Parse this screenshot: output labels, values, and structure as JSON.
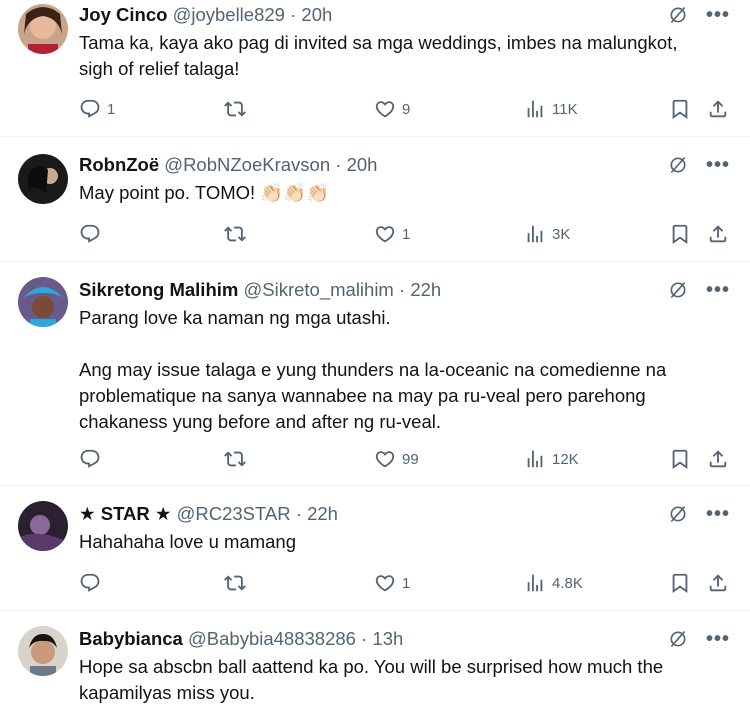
{
  "tweets": [
    {
      "name": "Joy Cinco",
      "handle": "@joybelle829",
      "time": "20h",
      "text": "Tama ka, kaya ako pag di invited sa mga weddings, imbes na malungkot,\nsigh of relief talaga!",
      "replies": "1",
      "retweets": "",
      "likes": "9",
      "views": "11K"
    },
    {
      "name": "RobnZoë",
      "handle": "@RobNZoeKravson",
      "time": "20h",
      "text": "May point po. TOMO! 👏🏻👏🏻👏🏻",
      "replies": "",
      "retweets": "",
      "likes": "1",
      "views": "3K"
    },
    {
      "name": "Sikretong Malihim",
      "handle": "@Sikreto_malihim",
      "time": "22h",
      "text": "Parang love ka naman ng mga utashi.\n\nAng may issue talaga e yung thunders na la-oceanic na comedienne na\nproblematique na sanya wannabee na may pa ru-veal pero parehong\nchakaness yung before and after ng ru-veal.",
      "replies": "",
      "retweets": "",
      "likes": "99",
      "views": "12K"
    },
    {
      "name": "★ STAR ★",
      "handle": "@RC23STAR",
      "time": "22h",
      "text": "Hahahaha love u mamang",
      "replies": "",
      "retweets": "",
      "likes": "1",
      "views": "4.8K"
    },
    {
      "name": "Babybianca",
      "handle": "@Babybia48838286",
      "time": "13h",
      "text": "Hope sa abscbn ball aattend ka po. You will be surprised how much the\nkapamilyas miss you.",
      "replies": "",
      "retweets": "",
      "likes": "",
      "views": ""
    }
  ],
  "separator": "·",
  "icons": {
    "reply": "reply-icon",
    "retweet": "retweet-icon",
    "like": "heart-icon",
    "views": "views-icon",
    "bookmark": "bookmark-icon",
    "share": "share-icon",
    "grok": "grok-icon",
    "more": "more-icon"
  },
  "colors": {
    "text": "#0f1419",
    "secondary": "#536471",
    "border": "#eff3f4"
  }
}
